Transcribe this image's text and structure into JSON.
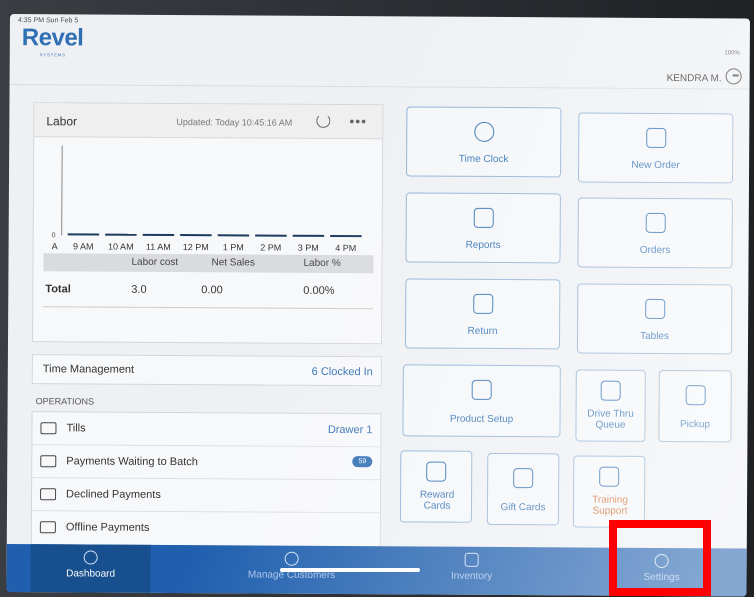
{
  "status": {
    "time": "4:35 PM  Sun Feb 5",
    "battery": "100%"
  },
  "brand": {
    "name": "Revel",
    "sub": "SYSTEMS"
  },
  "user": {
    "name": "KENDRA M."
  },
  "labor": {
    "title": "Labor",
    "updated": "Updated: Today 10:45:16 AM",
    "legend": {
      "c1": "Labor cost",
      "c2": "Net Sales",
      "c3": "Labor %"
    },
    "total": {
      "label": "Total",
      "cost": "3.0",
      "sales": "0.00",
      "pct": "0.00%"
    }
  },
  "chart_data": {
    "type": "bar",
    "categories": [
      "9 AM",
      "10 AM",
      "11 AM",
      "12 PM",
      "1 PM",
      "2 PM",
      "3 PM",
      "4 PM"
    ],
    "values": [
      0,
      0,
      0,
      0,
      0,
      0,
      0,
      0
    ],
    "ylabel_tick": "0",
    "first_tick_partial": "A"
  },
  "time_management": {
    "label": "Time Management",
    "value": "6 Clocked In"
  },
  "operations": {
    "title": "OPERATIONS",
    "items": [
      {
        "label": "Tills",
        "value": "Drawer 1"
      },
      {
        "label": "Payments Waiting to Batch",
        "badge": "59"
      },
      {
        "label": "Declined Payments"
      },
      {
        "label": "Offline Payments"
      }
    ]
  },
  "tiles": {
    "time_clock": "Time Clock",
    "new_order": "New Order",
    "reports": "Reports",
    "orders": "Orders",
    "return": "Return",
    "tables": "Tables",
    "product_setup": "Product Setup",
    "drive_thru": "Drive Thru Queue",
    "pickup": "Pickup",
    "reward_cards": "Reward Cards",
    "gift_cards": "Gift Cards",
    "training_support": "Training Support"
  },
  "tabs": {
    "dashboard": "Dashboard",
    "customers": "Manage Customers",
    "inventory": "Inventory",
    "settings": "Settings"
  },
  "colors": {
    "accent": "#2f6fb3",
    "tabbar": "#1f5fae",
    "highlight": "#ff0000"
  }
}
